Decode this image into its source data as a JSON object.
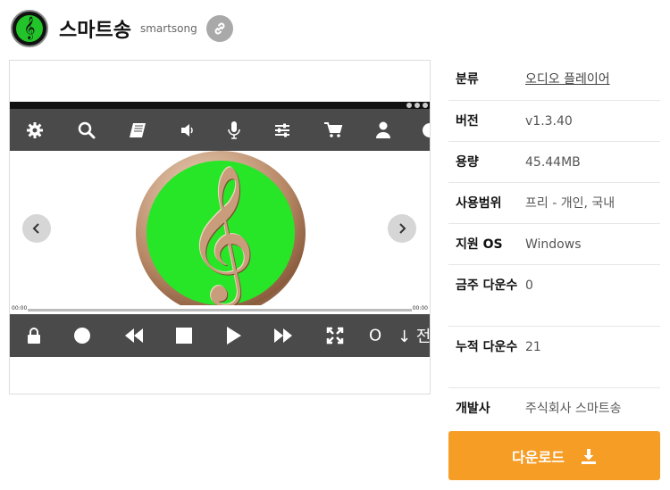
{
  "header": {
    "title": "스마트송",
    "subtitle": "smartsong",
    "logo_icon": "treble-clef-logo",
    "link_icon": "link-icon"
  },
  "screenshot": {
    "time_start": "00:00",
    "time_end": "00:00",
    "partial_text": "↓ 전",
    "top_toolbar_icons": [
      "gear-icon",
      "search-icon",
      "book-icon",
      "volume-icon",
      "microphone-icon",
      "sliders-icon",
      "cart-icon",
      "user-icon"
    ],
    "bottom_toolbar_icons": [
      "lock-icon",
      "record-icon",
      "rewind-icon",
      "stop-icon",
      "play-icon",
      "fast-forward-icon",
      "fullscreen-icon"
    ],
    "bottom_circle_text": "O"
  },
  "info": {
    "rows": [
      {
        "key": "분류",
        "value": "오디오 플레이어"
      },
      {
        "key": "버전",
        "value": "v1.3.40"
      },
      {
        "key": "용량",
        "value": "45.44MB"
      },
      {
        "key": "사용범위",
        "value": "프리 - 개인, 국내"
      },
      {
        "key": "지원 OS",
        "value": "Windows"
      },
      {
        "key": "금주 다운수",
        "value": "0"
      },
      {
        "key": "누적 다운수",
        "value": "21"
      },
      {
        "key": "개발사",
        "value": "주식회사 스마트송"
      }
    ]
  },
  "download": {
    "label": "다운로드",
    "icon": "download-icon"
  },
  "colors": {
    "accent": "#f59d25",
    "toolbar": "#4a4a4a",
    "disc_green": "#27e627"
  }
}
